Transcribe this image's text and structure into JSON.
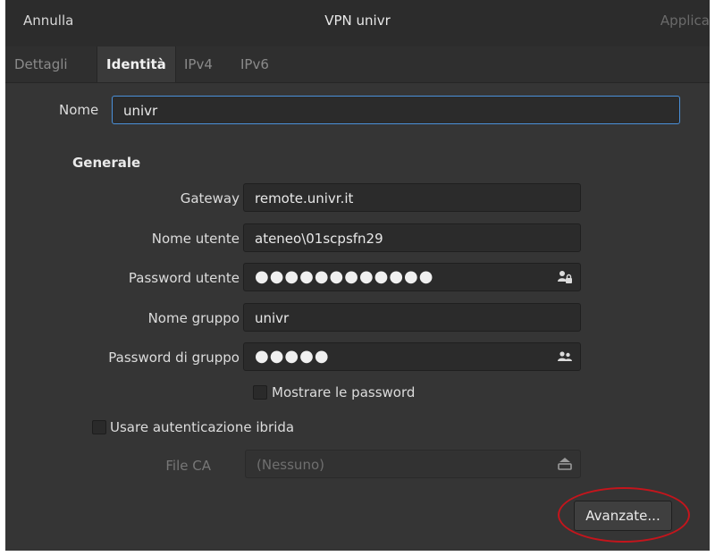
{
  "header": {
    "cancel_label": "Annulla",
    "title": "VPN univr",
    "apply_label": "Applica"
  },
  "tabs": [
    {
      "label": "Dettagli"
    },
    {
      "label": "Identità",
      "active": true
    },
    {
      "label": "IPv4"
    },
    {
      "label": "IPv6"
    }
  ],
  "name": {
    "label": "Nome",
    "value": "univr"
  },
  "general": {
    "heading": "Generale",
    "gateway": {
      "label": "Gateway",
      "value": "remote.univr.it"
    },
    "username": {
      "label": "Nome utente",
      "value": "ateneo\\01scpsfn29"
    },
    "user_password": {
      "label": "Password utente",
      "value": "●●●●●●●●●●●●",
      "icon": "user-lock-icon"
    },
    "group_name": {
      "label": "Nome gruppo",
      "value": "univr"
    },
    "group_password": {
      "label": "Password di gruppo",
      "value": "●●●●●",
      "icon": "users-icon"
    },
    "show_passwords": {
      "label": "Mostrare le password",
      "checked": false
    },
    "hybrid_auth": {
      "label": "Usare autenticazione ibrida",
      "checked": false
    },
    "ca_file": {
      "label": "File CA",
      "value": "(Nessuno)",
      "icon": "file-open-icon"
    }
  },
  "advanced_button": {
    "label": "Avanzate..."
  },
  "colors": {
    "highlight_ring": "#c4151c",
    "focus": "#4a90d9",
    "background": "#353535"
  }
}
